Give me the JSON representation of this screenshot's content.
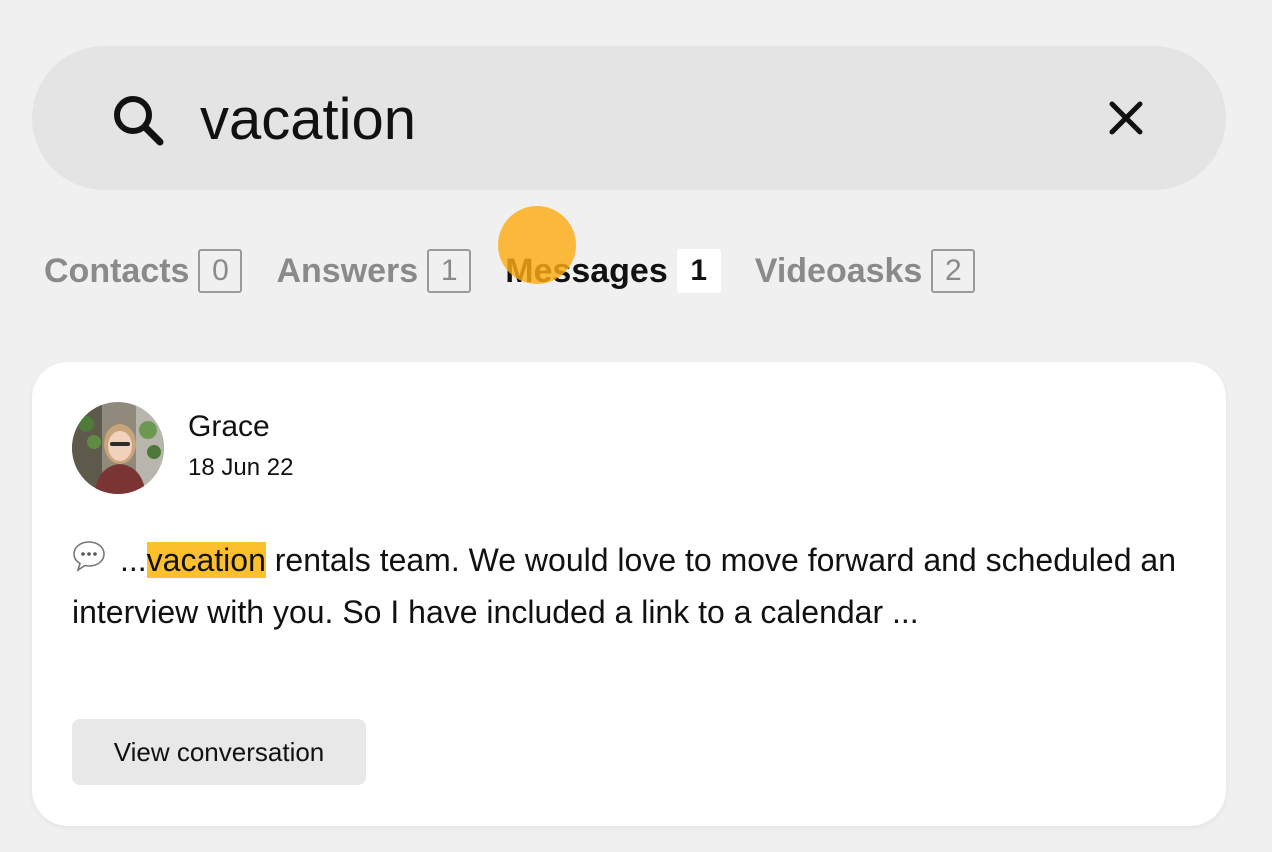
{
  "search": {
    "value": "vacation"
  },
  "tabs": [
    {
      "label": "Contacts",
      "count": "0"
    },
    {
      "label": "Answers",
      "count": "1"
    },
    {
      "label": "Messages",
      "count": "1"
    },
    {
      "label": "Videoasks",
      "count": "2"
    }
  ],
  "result": {
    "sender": "Grace",
    "date": "18 Jun 22",
    "prefix": "...",
    "match": "vacation",
    "rest": " rentals team. We would love to move forward and scheduled an interview with you. So I have included a link to a calendar ...",
    "button_label": "View conversation"
  },
  "colors": {
    "highlight": "#fcc02c",
    "cursor": "#fcac14"
  },
  "icons": {
    "search": "search-icon",
    "clear": "close-icon",
    "message": "speech-bubble-icon"
  }
}
